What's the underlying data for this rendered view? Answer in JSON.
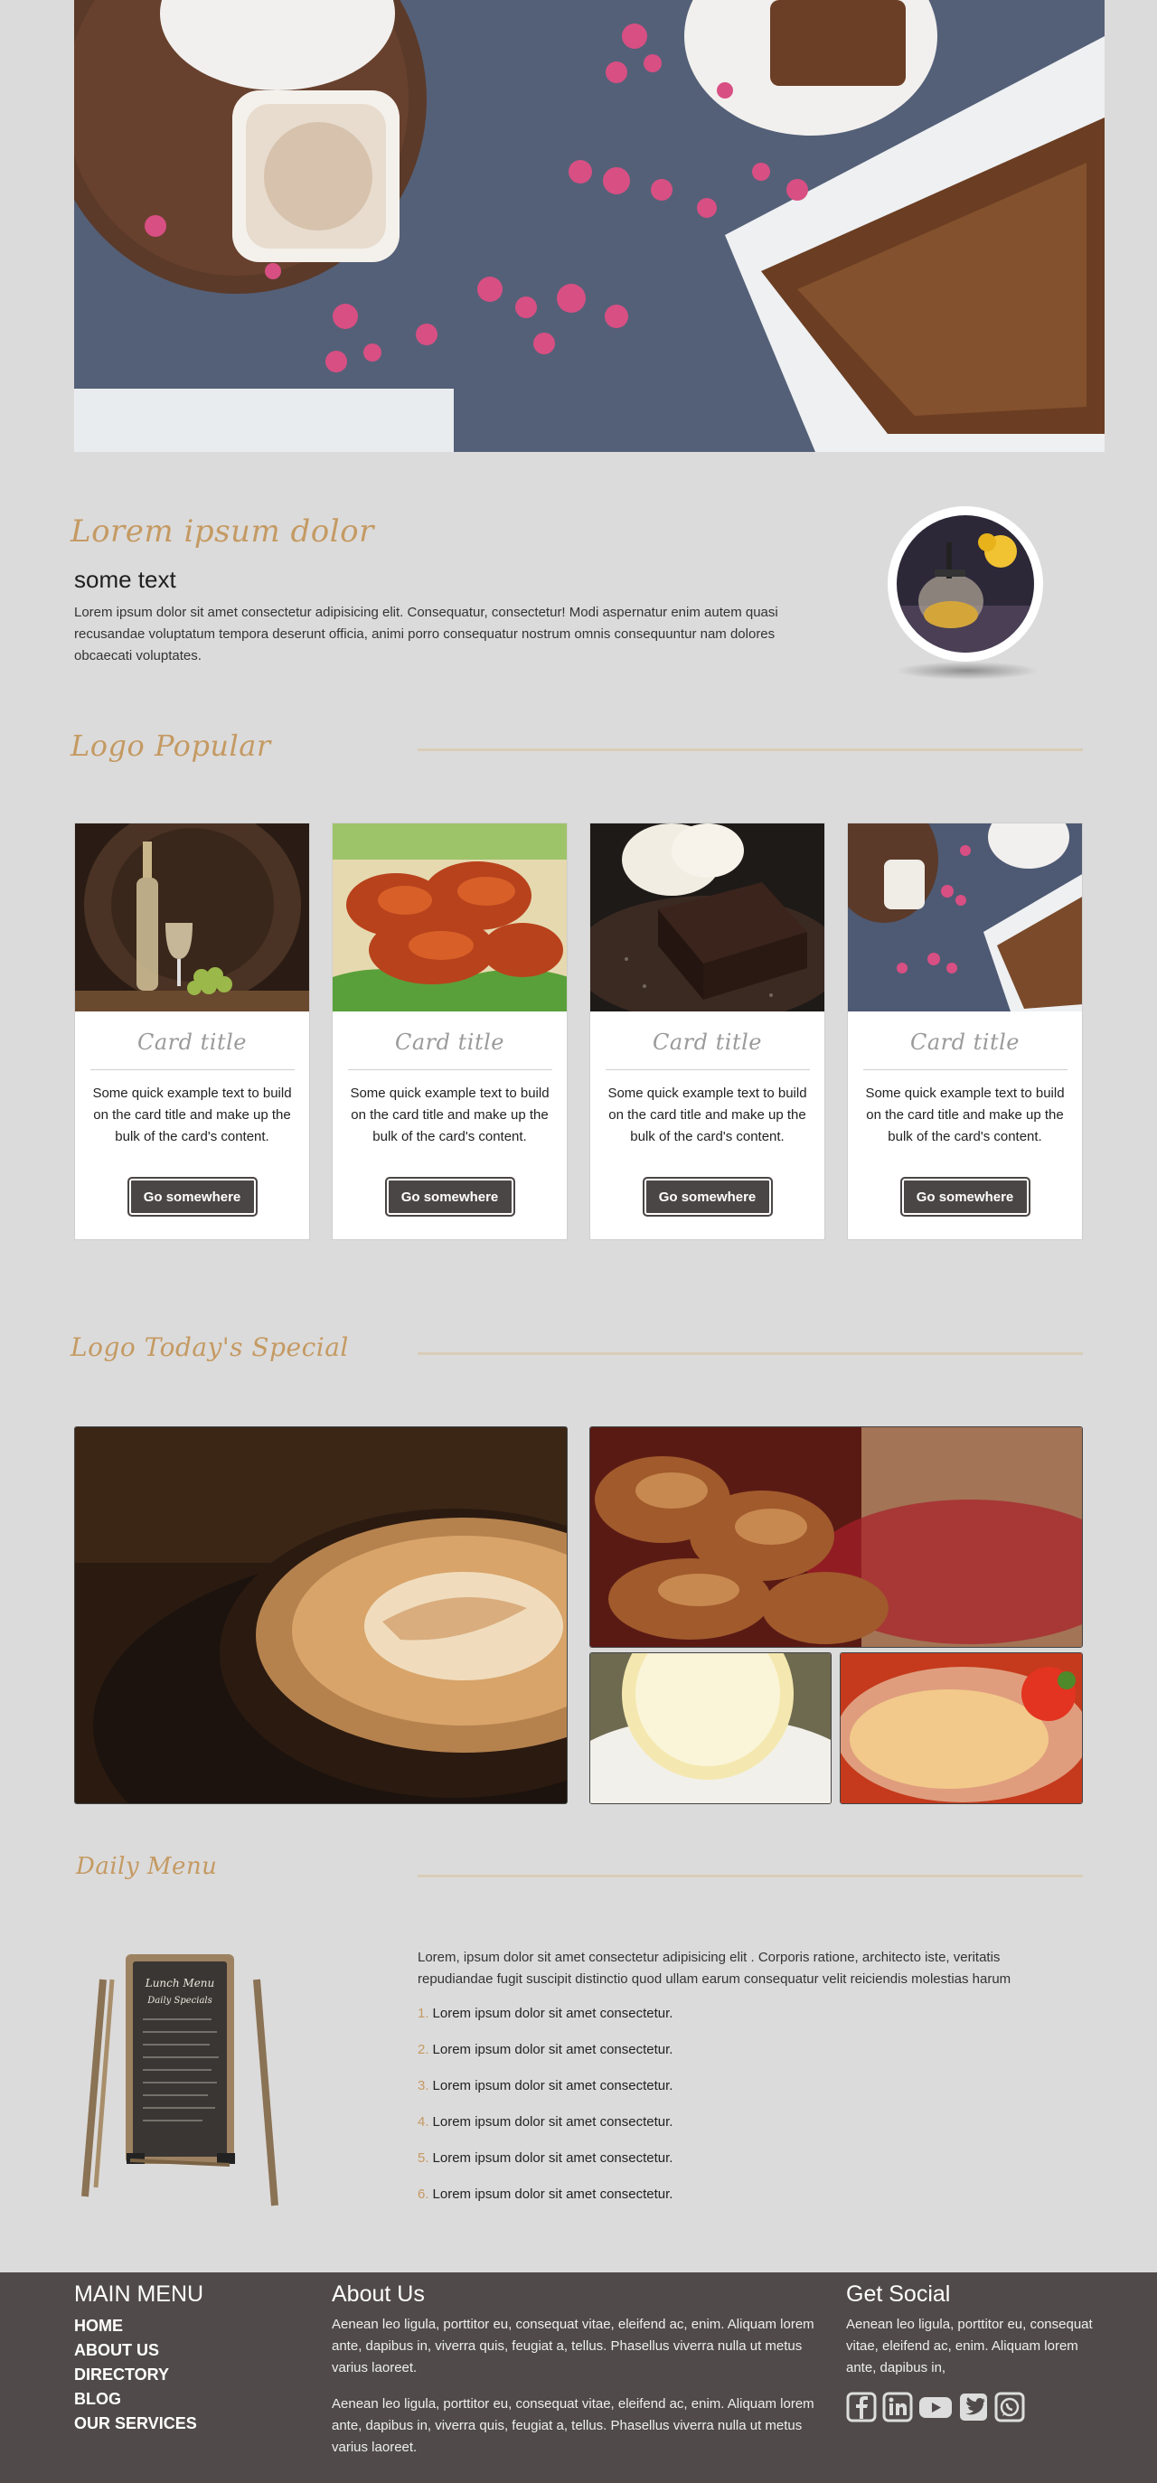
{
  "hero": {
    "alt": ""
  },
  "intro": {
    "title": "Lorem ipsum dolor",
    "subtitle": "some text",
    "text": "Lorem ipsum dolor sit amet consectetur adipisicing elit. Consequatur, consectetur! Modi aspernatur enim autem quasi recusandae voluptatum tempora deserunt officia, animi porro consequatur nostrum omnis consequuntur nam dolores obcaecati voluptates."
  },
  "popular": {
    "title": "Logo Popular",
    "cards": [
      {
        "title": "Card title",
        "text": "Some quick example text to build on the card title and make up the bulk of the card's content.",
        "button": "Go somewhere"
      },
      {
        "title": "Card title",
        "text": "Some quick example text to build on the card title and make up the bulk of the card's content.",
        "button": "Go somewhere"
      },
      {
        "title": "Card title",
        "text": "Some quick example text to build on the card title and make up the bulk of the card's content.",
        "button": "Go somewhere"
      },
      {
        "title": "Card title",
        "text": "Some quick example text to build on the card title and make up the bulk of the card's content.",
        "button": "Go somewhere"
      }
    ]
  },
  "special": {
    "title": "Logo Today's Special"
  },
  "daily": {
    "title": "Daily Menu",
    "intro": "Lorem, ipsum dolor sit amet consectetur adipisicing elit . Corporis ratione, architecto iste, veritatis repudiandae fugit suscipit distinctio quod ullam earum consequatur velit reiciendis molestias harum",
    "items": [
      {
        "num": "1.",
        "text": "Lorem ipsum dolor sit amet consectetur."
      },
      {
        "num": "2.",
        "text": "Lorem ipsum dolor sit amet consectetur."
      },
      {
        "num": "3.",
        "text": "Lorem ipsum dolor sit amet consectetur."
      },
      {
        "num": "4.",
        "text": "Lorem ipsum dolor sit amet consectetur."
      },
      {
        "num": "5.",
        "text": "Lorem ipsum dolor sit amet consectetur."
      },
      {
        "num": "6.",
        "text": "Lorem ipsum dolor sit amet consectetur."
      }
    ],
    "board": {
      "line1": "Lunch Menu",
      "line2": "Daily Specials"
    }
  },
  "footer": {
    "menu_title": "MAIN MENU",
    "menu_items": [
      "HOME",
      "ABOUT US",
      "DIRECTORY",
      "BLOG",
      "OUR SERVICES"
    ],
    "about_title": "About Us",
    "about_p1": "Aenean leo ligula, porttitor eu, consequat vitae, eleifend ac, enim. Aliquam lorem ante, dapibus in, viverra quis, feugiat a, tellus. Phasellus viverra nulla ut metus varius laoreet.",
    "about_p2": "Aenean leo ligula, porttitor eu, consequat vitae, eleifend ac, enim. Aliquam lorem ante, dapibus in, viverra quis, feugiat a, tellus. Phasellus viverra nulla ut metus varius laoreet.",
    "social_title": "Get Social",
    "social_text": "Aenean leo ligula, porttitor eu, consequat vitae, eleifend ac, enim. Aliquam lorem ante, dapibus in,",
    "social_icons": [
      "facebook-icon",
      "linkedin-icon",
      "youtube-icon",
      "twitter-icon",
      "whatsapp-icon"
    ]
  },
  "colors": {
    "accent": "#c49a63",
    "footer": "#504a4a",
    "page": "#dcdbdb",
    "button": "#4b4646"
  }
}
